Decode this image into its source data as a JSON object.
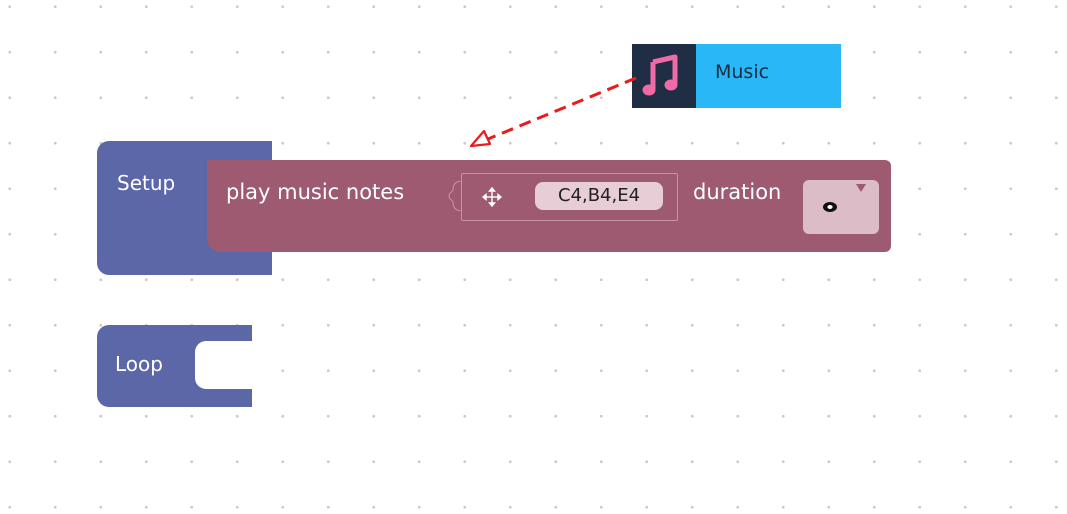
{
  "blocks": {
    "setup": {
      "label": "Setup"
    },
    "loop": {
      "label": "Loop"
    },
    "music": {
      "label": "play music notes",
      "notes": "C4,B4,E4",
      "duration_label": "duration"
    }
  },
  "tooltip": {
    "label": "Music"
  },
  "colors": {
    "hat_block": "#5b67a6",
    "music_block": "#9e5a70",
    "tooltip_accent": "#2ab7f7",
    "tooltip_icon_bg": "#1f2d45",
    "arrow": "#e81c1c"
  },
  "icons": {
    "tooltip": "music-note-icon",
    "socket": "move-icon",
    "duration": "eye-icon",
    "dropdown": "chevron-down-icon"
  }
}
